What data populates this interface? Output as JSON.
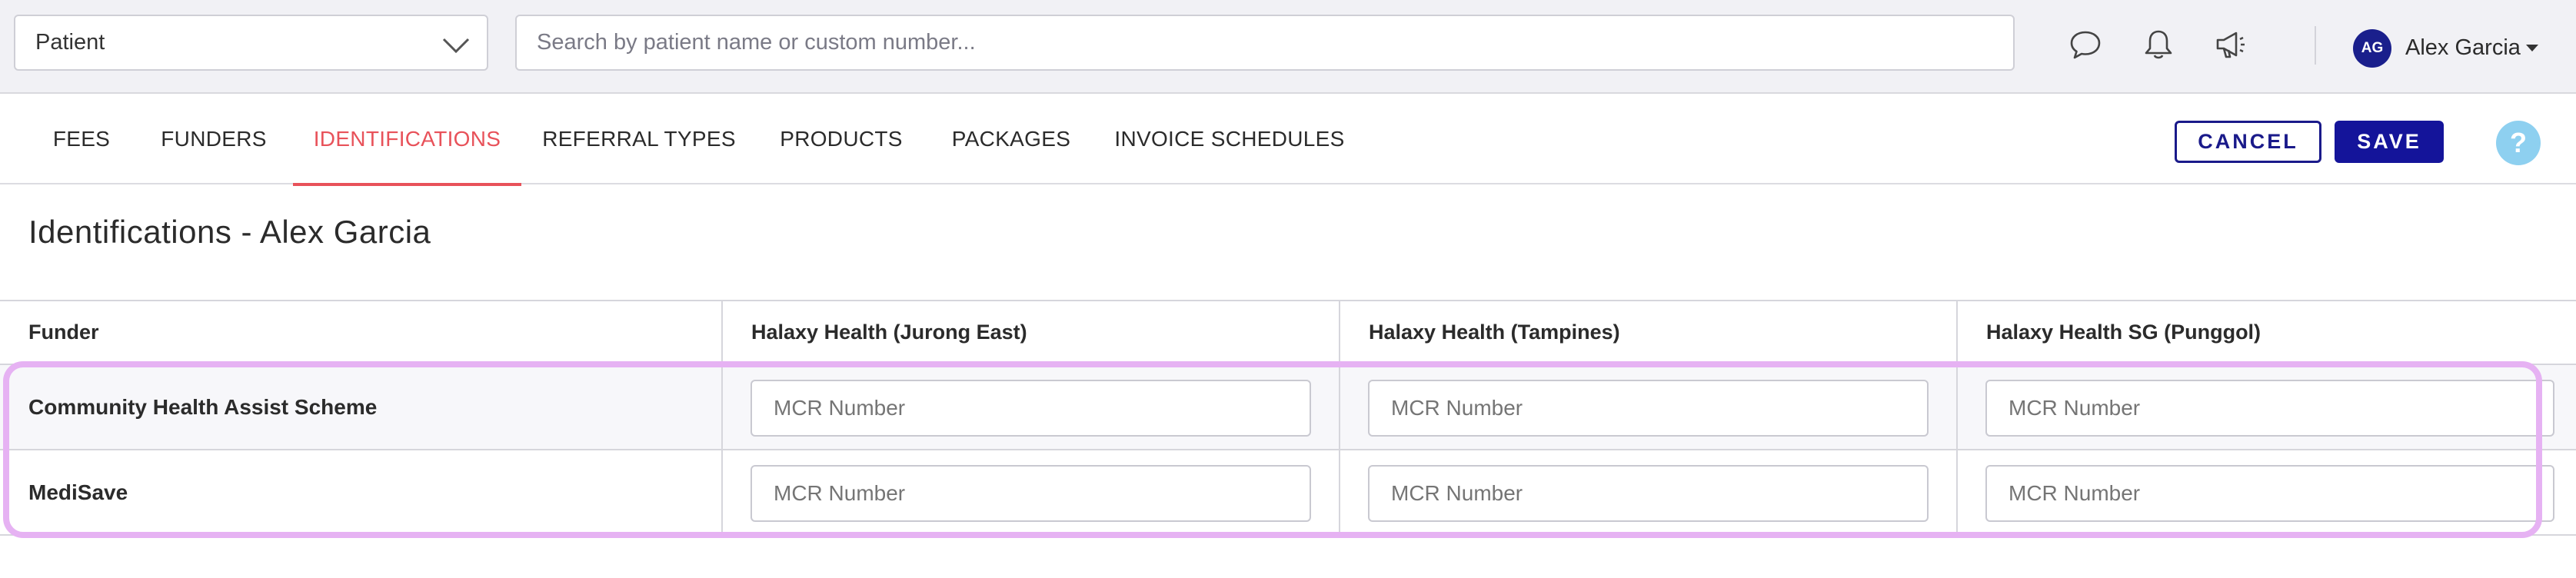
{
  "topbar": {
    "patient_select_value": "Patient",
    "search_placeholder": "Search by patient name or custom number...",
    "user_initials": "AG",
    "user_name": "Alex Garcia"
  },
  "tabs": [
    {
      "label": "FEES"
    },
    {
      "label": "FUNDERS"
    },
    {
      "label": "IDENTIFICATIONS",
      "active": true
    },
    {
      "label": "REFERRAL TYPES"
    },
    {
      "label": "PRODUCTS"
    },
    {
      "label": "PACKAGES"
    },
    {
      "label": "INVOICE SCHEDULES"
    }
  ],
  "actions": {
    "cancel_label": "CANCEL",
    "save_label": "SAVE",
    "help_label": "?"
  },
  "page": {
    "title": "Identifications - Alex Garcia"
  },
  "table": {
    "headers": [
      "Funder",
      "Halaxy Health (Jurong East)",
      "Halaxy Health (Tampines)",
      "Halaxy Health SG (Punggol)"
    ],
    "rows": [
      {
        "funder": "Community Health Assist Scheme",
        "fields": [
          {
            "value": "",
            "placeholder": "MCR Number"
          },
          {
            "value": "",
            "placeholder": "MCR Number"
          },
          {
            "value": "",
            "placeholder": "MCR Number"
          }
        ]
      },
      {
        "funder": "MediSave",
        "fields": [
          {
            "value": "",
            "placeholder": "MCR Number"
          },
          {
            "value": "",
            "placeholder": "MCR Number"
          },
          {
            "value": "",
            "placeholder": "MCR Number"
          }
        ]
      }
    ]
  },
  "colors": {
    "accent_active_tab": "#e8525a",
    "primary_button": "#14149a",
    "avatar_bg": "#1a1f8c",
    "help_bg": "#8ed0f0",
    "highlight_border": "#e6b2f3"
  },
  "icons": {
    "patient_select": "chevron-down-icon",
    "chat": "chat-bubble-icon",
    "notifications": "bell-icon",
    "announcements": "megaphone-icon",
    "user_menu": "caret-down-icon"
  }
}
